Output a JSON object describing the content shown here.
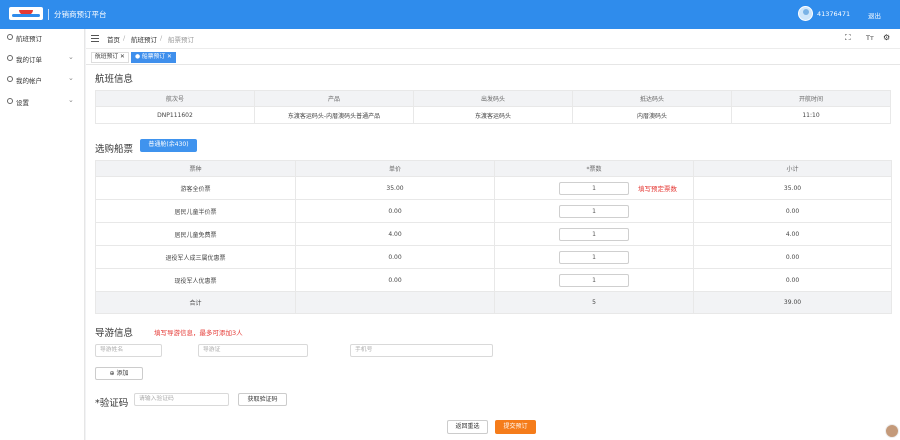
{
  "header": {
    "brand": "分销商预订平台",
    "user": "41376471",
    "logout": "退出"
  },
  "sidebar": {
    "items": [
      {
        "label": "航班预订",
        "has_children": false
      },
      {
        "label": "我的订单",
        "has_children": true
      },
      {
        "label": "我的帐户",
        "has_children": true
      },
      {
        "label": "设置",
        "has_children": true
      }
    ]
  },
  "breadcrumb": [
    "首页",
    "航班预订",
    "船票预订"
  ],
  "tabs": [
    {
      "label": "航班预订",
      "active": false
    },
    {
      "label": "船票预订",
      "active": true
    }
  ],
  "flight": {
    "title": "航班信息",
    "headers": [
      "航次号",
      "产品",
      "出发码头",
      "抵达码头",
      "开航时间"
    ],
    "row": [
      "DNP111602",
      "东渡客运码头-内厝澳码头普通产品",
      "东渡客运码头",
      "内厝澳码头",
      "11:10"
    ]
  },
  "tickets": {
    "title": "选购船票",
    "class_button": "普通舱(余430)",
    "headers": [
      "票种",
      "单价",
      "*票数",
      "小计"
    ],
    "rows": [
      {
        "type": "游客全价票",
        "price": "35.00",
        "qty": "1",
        "subtotal": "35.00",
        "hint": "填写预定票数"
      },
      {
        "type": "居民儿童半价票",
        "price": "0.00",
        "qty": "1",
        "subtotal": "0.00",
        "hint": ""
      },
      {
        "type": "居民儿童免费票",
        "price": "4.00",
        "qty": "1",
        "subtotal": "4.00",
        "hint": ""
      },
      {
        "type": "退役军人成三属优惠票",
        "price": "0.00",
        "qty": "1",
        "subtotal": "0.00",
        "hint": ""
      },
      {
        "type": "现役军人优惠票",
        "price": "0.00",
        "qty": "1",
        "subtotal": "0.00",
        "hint": ""
      }
    ],
    "total_label": "合计",
    "total_qty": "5",
    "total_amount": "39.00"
  },
  "guide": {
    "title": "导游信息",
    "hint": "填写导游信息，最多可添加3人",
    "name_placeholder": "导游姓名",
    "cert_placeholder": "导游证",
    "phone_placeholder": "手机号",
    "add_label": "添加"
  },
  "captcha": {
    "title": "*验证码",
    "placeholder": "请输入验证码",
    "get_label": "获取验证码"
  },
  "actions": {
    "back": "返回重选",
    "submit": "提交预订"
  },
  "colors": {
    "primary": "#2f8cec",
    "accent": "#f57c1a",
    "hint": "#e53935"
  }
}
